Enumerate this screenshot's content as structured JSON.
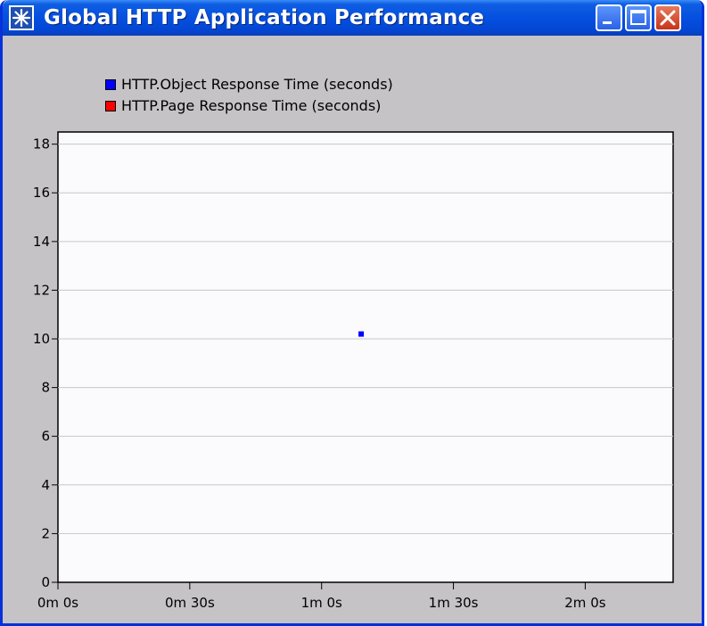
{
  "window": {
    "title": "Global HTTP Application Performance",
    "icon": "star-burst-icon",
    "controls": [
      "minimize-icon",
      "maximize-icon",
      "close-icon"
    ]
  },
  "colors": {
    "titlebar": "#0550df",
    "window_bg": "#c6c3c6",
    "plot_bg": "#fbfbfd",
    "series_object": "#0000ff",
    "series_page": "#ff0000"
  },
  "chart_data": {
    "type": "scatter",
    "title": "",
    "xlabel": "",
    "ylabel": "",
    "legend_position": "top-left",
    "grid": "horizontal",
    "xlim": [
      0,
      140
    ],
    "ylim": [
      0,
      18.5
    ],
    "x_ticks": [
      {
        "value": 0,
        "label": "0m 0s"
      },
      {
        "value": 30,
        "label": "0m 30s"
      },
      {
        "value": 60,
        "label": "1m 0s"
      },
      {
        "value": 90,
        "label": "1m 30s"
      },
      {
        "value": 120,
        "label": "2m 0s"
      }
    ],
    "y_ticks": [
      {
        "value": 0,
        "label": "0"
      },
      {
        "value": 2,
        "label": "2"
      },
      {
        "value": 4,
        "label": "4"
      },
      {
        "value": 6,
        "label": "6"
      },
      {
        "value": 8,
        "label": "8"
      },
      {
        "value": 10,
        "label": "10"
      },
      {
        "value": 12,
        "label": "12"
      },
      {
        "value": 14,
        "label": "14"
      },
      {
        "value": 16,
        "label": "16"
      },
      {
        "value": 18,
        "label": "18"
      }
    ],
    "series": [
      {
        "name": "HTTP.Object Response Time (seconds)",
        "color": "#0000ff",
        "points": [
          {
            "x": 69,
            "y": 10.2
          }
        ]
      },
      {
        "name": "HTTP.Page Response Time (seconds)",
        "color": "#ff0000",
        "points": []
      }
    ]
  }
}
